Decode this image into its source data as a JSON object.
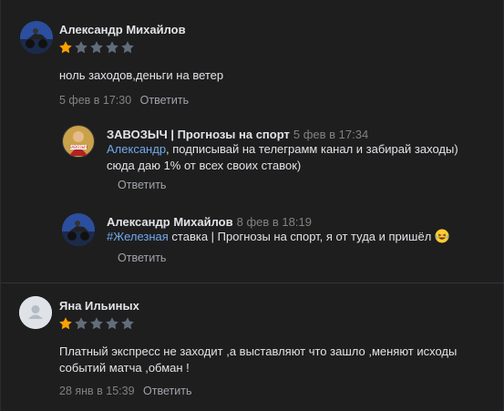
{
  "comments": [
    {
      "author": "Александр Михайлов",
      "rating": 1,
      "text": "ноль заходов,деньги на ветер",
      "date": "5 фев в 17:30",
      "reply_label": "Ответить",
      "replies": [
        {
          "author": "ЗАВОЗЫЧ | Прогнозы на спорт",
          "date": "5 фев в 17:34",
          "mention": "Александр",
          "text": ", подписывай на телеграмм канал и забирай заходы) сюда даю 1% от всех своих ставок)",
          "reply_label": "Ответить"
        },
        {
          "author": "Александр Михайлов",
          "date": "8 фев в 18:19",
          "mention": "#Железная",
          "text": " ставка | Прогнозы на спорт, я от туда и пришёл",
          "emoji": "laughing-tears-emoji",
          "reply_label": "Ответить"
        }
      ]
    },
    {
      "author": "Яна Ильиных",
      "rating": 1,
      "text": "Платный экспресс не заходит ,а выставляют что зашло ,меняют исходы событий матча ,обман !",
      "date": "28 янв в 15:39",
      "reply_label": "Ответить"
    }
  ],
  "colors": {
    "background": "#1e1e1f",
    "link": "#71aaeb",
    "star_filled": "#ffa000",
    "star_empty": "#626d7a",
    "muted": "#828282"
  }
}
